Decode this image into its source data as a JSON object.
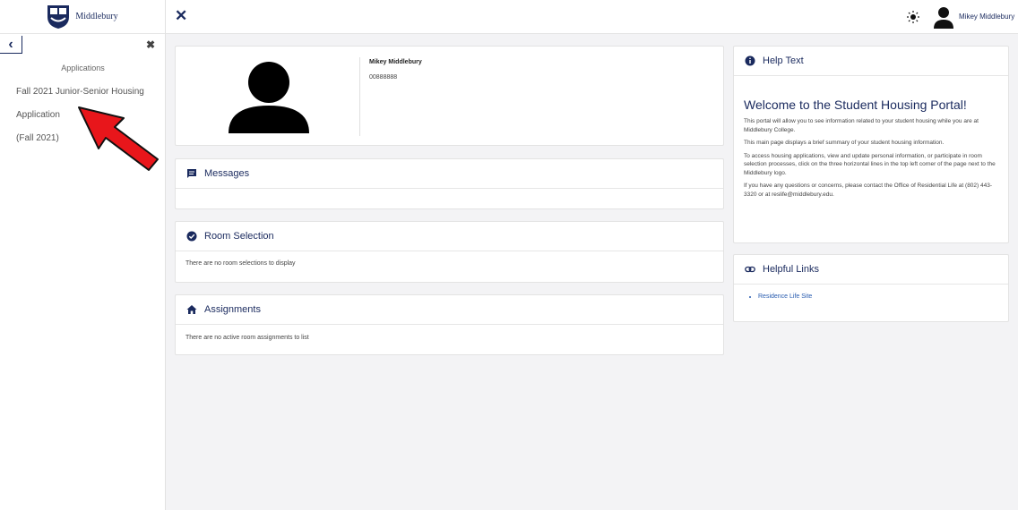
{
  "logo": {
    "text": "Middlebury"
  },
  "sidebar": {
    "heading": "Applications",
    "items": [
      {
        "label": "Fall 2021 Junior-Senior Housing"
      },
      {
        "label": "Application"
      },
      {
        "label": "(Fall 2021)"
      }
    ],
    "back_icon": "chevron-left-icon",
    "close_icon": "close-icon"
  },
  "topbar": {
    "close_icon": "close-icon",
    "theme_icon": "sun-icon",
    "user_name": "Mikey Middlebury"
  },
  "profile": {
    "name": "Mikey Middlebury",
    "id": "00888888"
  },
  "messages": {
    "title": "Messages"
  },
  "room_selection": {
    "title": "Room Selection",
    "empty": "There are no room selections to display"
  },
  "assignments": {
    "title": "Assignments",
    "empty": "There are no active room assignments to list"
  },
  "help": {
    "title": "Help Text",
    "welcome": "Welcome to the Student Housing Portal!",
    "paragraphs": [
      "This portal will allow you to see information related to your student housing while you are at Middlebury College.",
      "This main page displays a brief summary of your student housing information.",
      "To access housing applications, view and update personal information, or participate in room selection processes, click on the three horizontal lines in the top left corner of the page next to the Middlebury logo.",
      "If you have any questions or concerns, please contact the Office of Residential Life at (802) 443-3320 or at reslife@middlebury.edu."
    ]
  },
  "links": {
    "title": "Helpful Links",
    "items": [
      {
        "label": "Residence Life Site"
      }
    ]
  },
  "colors": {
    "accent": "#1a2a5e",
    "link": "#2a5db0",
    "arrow": "#e8161b",
    "background": "#f3f3f5"
  }
}
